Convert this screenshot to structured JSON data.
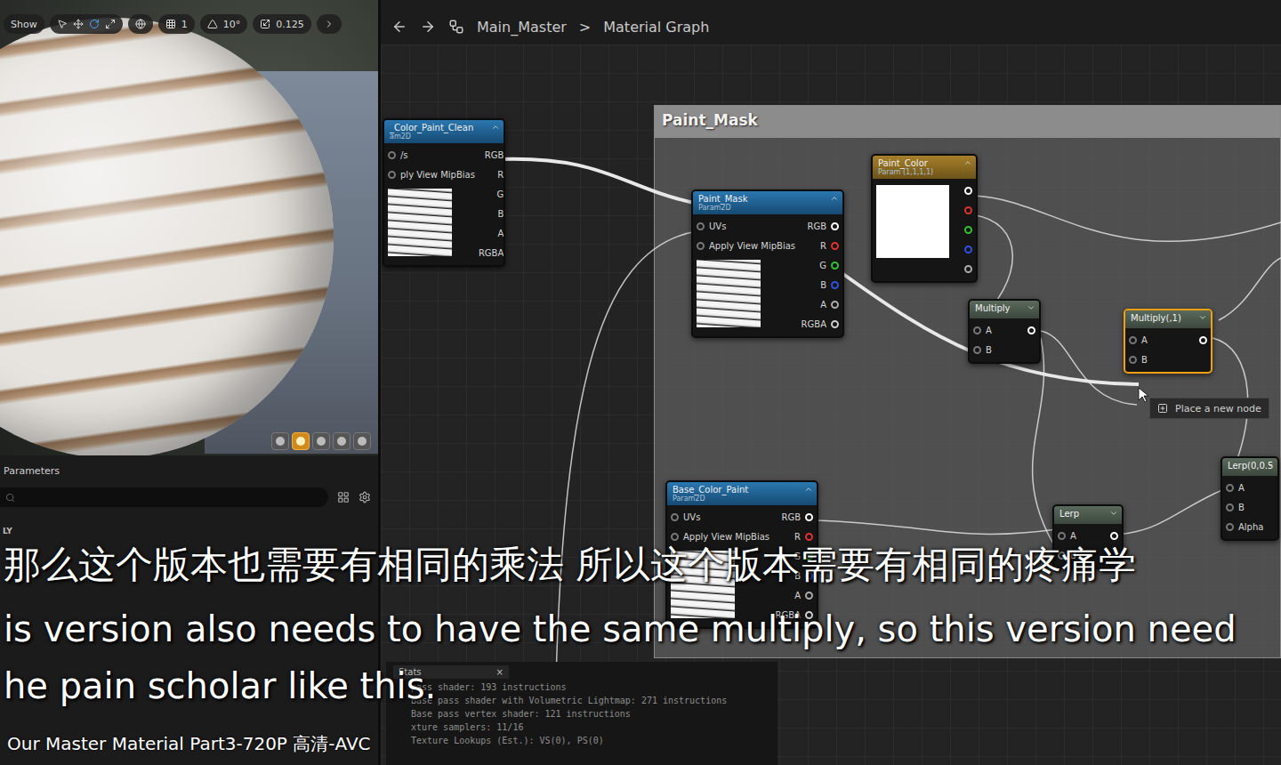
{
  "viewport": {
    "toolbar": [
      {
        "label": "Show"
      },
      {
        "label": "1"
      },
      {
        "label": "10°"
      },
      {
        "label": "0.125"
      }
    ],
    "view_modes": [
      {
        "selected": false
      },
      {
        "selected": true
      },
      {
        "selected": false
      },
      {
        "selected": false
      },
      {
        "selected": false
      }
    ]
  },
  "parameters": {
    "title": "Parameters",
    "section": "LY"
  },
  "graph": {
    "breadcrumb": [
      "Main_Master",
      "Material Graph"
    ],
    "separator": ">"
  },
  "comment": {
    "title": "Paint_Mask"
  },
  "nodes": [
    {
      "title": "_Color_Paint_Clean",
      "subtitle": "am2D",
      "kind": "texture",
      "selected": false,
      "inputs": [
        "/s",
        "ply View MipBias"
      ],
      "outputs": [
        {
          "label": "RGB",
          "color": "#ffffff"
        },
        {
          "label": "R",
          "color": "#e03030"
        },
        {
          "label": "G",
          "color": "#30c030"
        },
        {
          "label": "B",
          "color": "#3050e0"
        },
        {
          "label": "A",
          "color": "#aaaaaa"
        },
        {
          "label": "RGBA",
          "color": "#cccccc"
        }
      ]
    },
    {
      "title": "Paint_Mask",
      "subtitle": "Param2D",
      "kind": "texture",
      "selected": false,
      "inputs": [
        "UVs",
        "Apply View MipBias"
      ],
      "outputs": [
        {
          "label": "RGB",
          "color": "#ffffff"
        },
        {
          "label": "R",
          "color": "#e03030"
        },
        {
          "label": "G",
          "color": "#30c030"
        },
        {
          "label": "B",
          "color": "#3050e0"
        },
        {
          "label": "A",
          "color": "#aaaaaa"
        },
        {
          "label": "RGBA",
          "color": "#cccccc"
        }
      ]
    },
    {
      "title": "Paint_Color",
      "subtitle": "Param (1,1,1,1)",
      "kind": "vector",
      "selected": false,
      "inputs": [],
      "outputs": [
        {
          "label": "",
          "color": "#ffffff"
        },
        {
          "label": "",
          "color": "#e03030"
        },
        {
          "label": "",
          "color": "#30c030"
        },
        {
          "label": "",
          "color": "#3050e0"
        },
        {
          "label": "",
          "color": "#aaaaaa"
        }
      ]
    },
    {
      "title": "Multiply",
      "subtitle": "",
      "kind": "math",
      "selected": false,
      "inputs": [
        "A",
        "B"
      ],
      "outputs": [
        {
          "label": "",
          "color": "#ffffff"
        }
      ]
    },
    {
      "title": "Multiply(,1)",
      "subtitle": "",
      "kind": "math",
      "selected": true,
      "inputs": [
        "A",
        "B"
      ],
      "outputs": [
        {
          "label": "",
          "color": "#ffffff"
        }
      ]
    },
    {
      "title": "Base_Color_Paint",
      "subtitle": "Param2D",
      "kind": "texture",
      "selected": false,
      "inputs": [
        "UVs",
        "Apply View MipBias"
      ],
      "outputs": [
        {
          "label": "RGB",
          "color": "#ffffff"
        },
        {
          "label": "R",
          "color": "#e03030"
        },
        {
          "label": "G",
          "color": "#30c030"
        },
        {
          "label": "B",
          "color": "#3050e0"
        },
        {
          "label": "A",
          "color": "#aaaaaa"
        },
        {
          "label": "RGBA",
          "color": "#cccccc"
        }
      ]
    },
    {
      "title": "Lerp",
      "subtitle": "",
      "kind": "math",
      "selected": false,
      "inputs": [
        "A",
        "B"
      ],
      "outputs": [
        {
          "label": "",
          "color": "#ffffff"
        }
      ]
    },
    {
      "title": "Lerp(0,0.5",
      "subtitle": "",
      "kind": "math",
      "selected": false,
      "inputs": [
        "A",
        "B",
        "Alpha"
      ],
      "outputs": []
    }
  ],
  "tooltip": "Place a new node",
  "stats": {
    "title": "Stats",
    "close": "×",
    "lines": [
      "pass shader: 193 instructions",
      "Base pass shader with Volumetric Lightmap: 271 instructions",
      "Base pass vertex shader: 121 instructions",
      "xture samplers: 11/16",
      "Texture Lookups (Est.): VS(0), PS(0)"
    ]
  },
  "subtitles": {
    "zh": "那么这个版本也需要有相同的乘法 所以这个版本需要有相同的疼痛学",
    "en": [
      "is version also needs to have the same multiply, so this version need",
      "he pain scholar like this."
    ]
  },
  "caption": "Our Master Material Part3-720P 高清-AVC"
}
